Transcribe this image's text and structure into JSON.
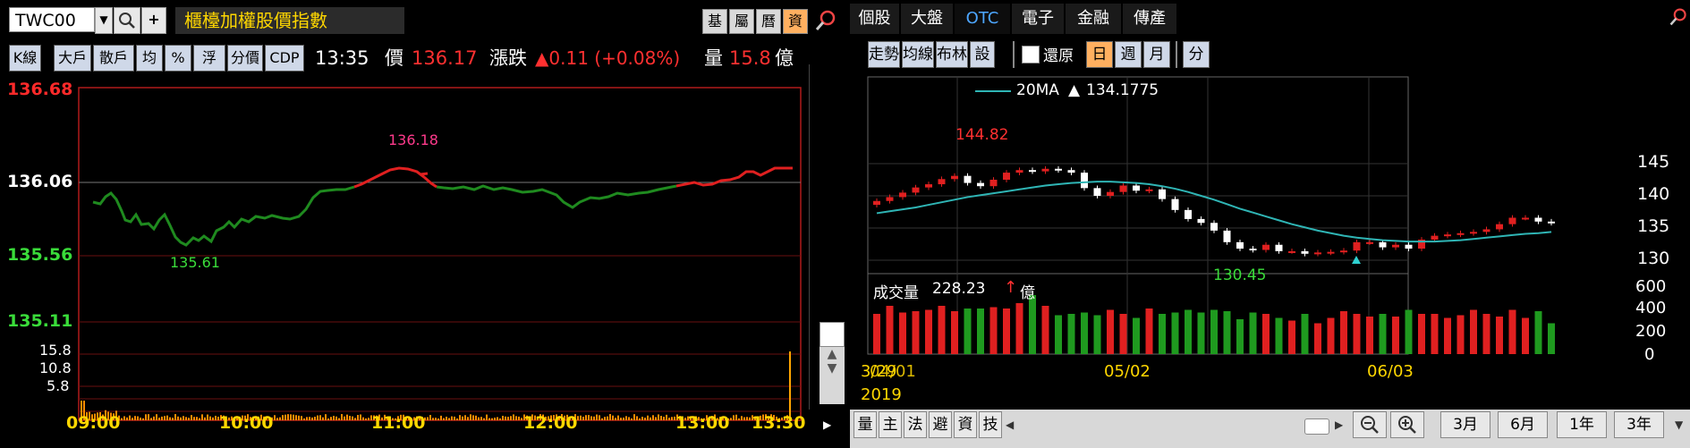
{
  "left": {
    "symbol": "TWC00",
    "title": "櫃檯加權股價指數",
    "tabs": [
      "基",
      "屬",
      "曆",
      "資"
    ],
    "buttons": [
      "K線",
      "大戶",
      "散戶",
      "均",
      "%",
      "浮",
      "分價",
      "CDP"
    ],
    "time": "13:35",
    "price_label": "價",
    "price": "136.17",
    "change_label": "漲跌",
    "change": "▲0.11 (+0.08%)",
    "volume_label": "量",
    "volume": "15.8",
    "volume_unit": "億",
    "y_labels": {
      "top": "136.68",
      "mid": "136.06",
      "low1": "135.56",
      "low2": "135.11"
    },
    "vol_labels": [
      "15.8",
      "10.8",
      "5.8"
    ],
    "time_labels": [
      "09:00",
      "10:00",
      "11:00",
      "12:00",
      "13:00",
      "13:30"
    ],
    "high_annotation": "136.18",
    "low_annotation": "135.61",
    "colors": {
      "up": "#e02020",
      "down": "#1f8a1f",
      "axis_red": "#ff2a2a",
      "axis_green": "#3adc3a",
      "time": "#ffd700"
    }
  },
  "right": {
    "tabs": [
      "個股",
      "大盤",
      "OTC",
      "電子",
      "金融",
      "傳產"
    ],
    "active_tab": "OTC",
    "buttons1": [
      "走勢",
      "均線",
      "布林",
      "設"
    ],
    "restore_label": "還原",
    "period_buttons": [
      "日",
      "週",
      "月"
    ],
    "split_button": "分",
    "ma_label": "20MA",
    "ma_value": "134.1775",
    "high_annotation": "144.82",
    "low_annotation": "130.45",
    "price_ticks": [
      "145",
      "140",
      "135",
      "130"
    ],
    "volume_title": "成交量",
    "volume_value": "228.23",
    "volume_unit": "億",
    "volume_ticks": [
      "600",
      "400",
      "200",
      "0"
    ],
    "date_labels": [
      "04/01",
      "05/02",
      "06/03"
    ],
    "date_overlay": "3/29",
    "year": "2019",
    "bottom_tabs": [
      "量",
      "主",
      "法",
      "避",
      "資",
      "技"
    ],
    "range_buttons": [
      "3月",
      "6月",
      "1年",
      "3年"
    ]
  }
}
